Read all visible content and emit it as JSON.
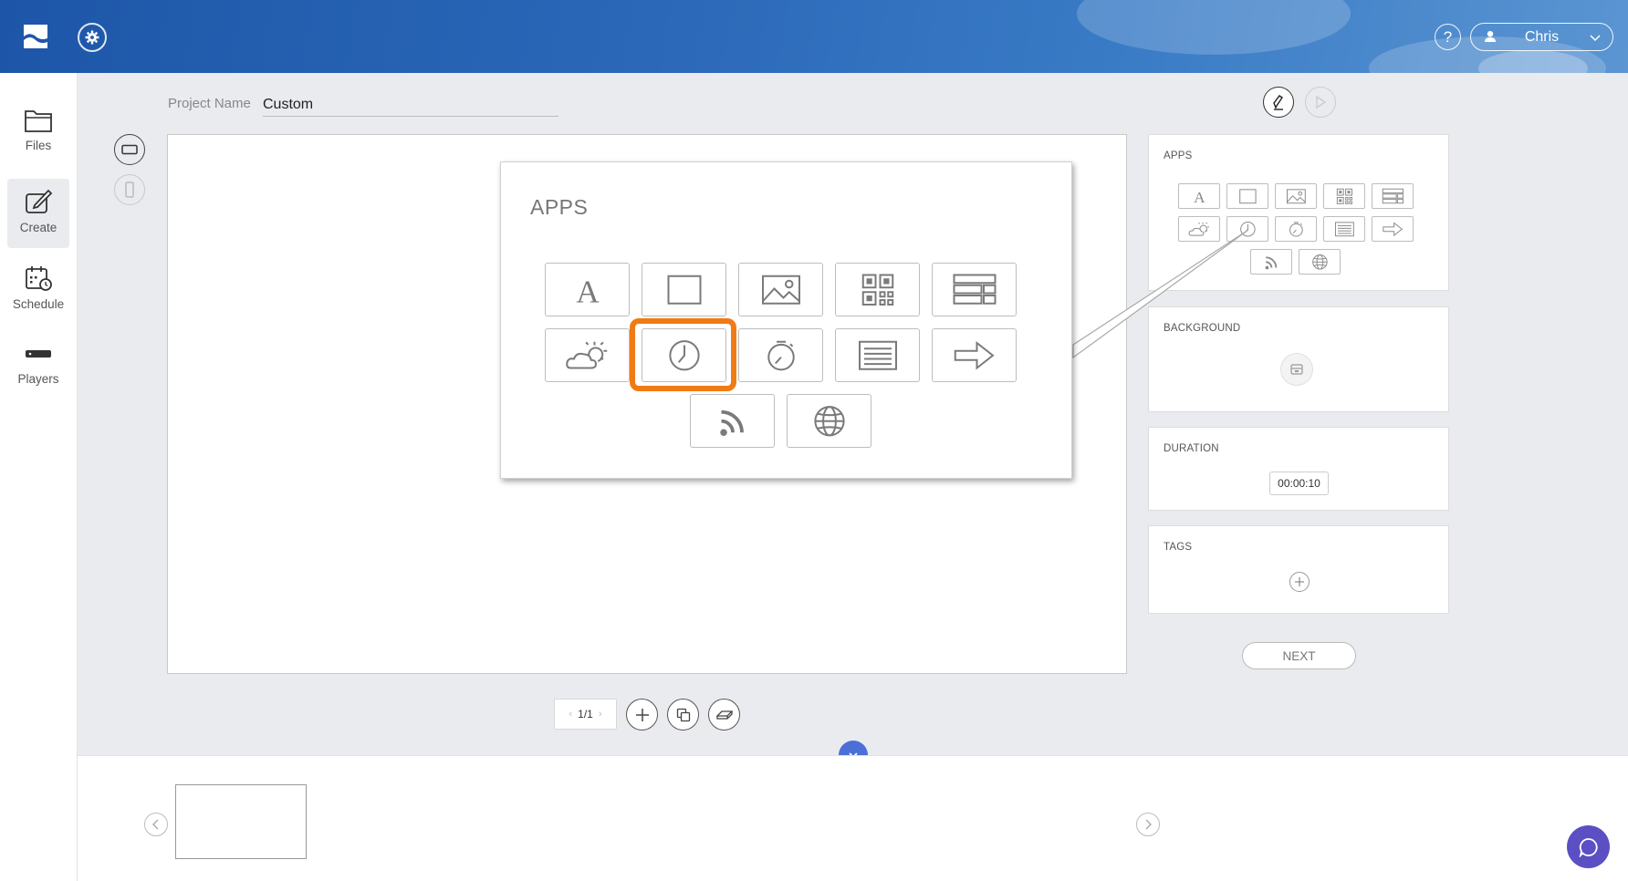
{
  "header": {
    "user_name": "Chris",
    "help_label": "?"
  },
  "sidebar": {
    "items": [
      {
        "label": "Files",
        "icon": "folder-icon"
      },
      {
        "label": "Create",
        "icon": "create-edit-icon",
        "active": true
      },
      {
        "label": "Schedule",
        "icon": "schedule-calendar-icon"
      },
      {
        "label": "Players",
        "icon": "player-device-icon"
      }
    ]
  },
  "project": {
    "label": "Project Name",
    "value": "Custom"
  },
  "right_panel": {
    "apps_title": "APPS",
    "background_title": "BACKGROUND",
    "duration_title": "DURATION",
    "duration_value": "00:00:10",
    "tags_title": "TAGS",
    "next_label": "NEXT"
  },
  "callout": {
    "title": "APPS",
    "highlight_color": "#f07b15"
  },
  "apps": [
    "text-icon",
    "rectangle-icon",
    "image-icon",
    "qr-code-icon",
    "table-icon",
    "weather-icon",
    "clock-icon",
    "timer-icon",
    "list-icon",
    "arrow-icon",
    "rss-feed-icon",
    "web-globe-icon"
  ],
  "pager": {
    "label": "1/1"
  },
  "colors": {
    "header": "#2b68b8",
    "accent": "#4b6fd6",
    "chat": "#5b4fc4"
  }
}
